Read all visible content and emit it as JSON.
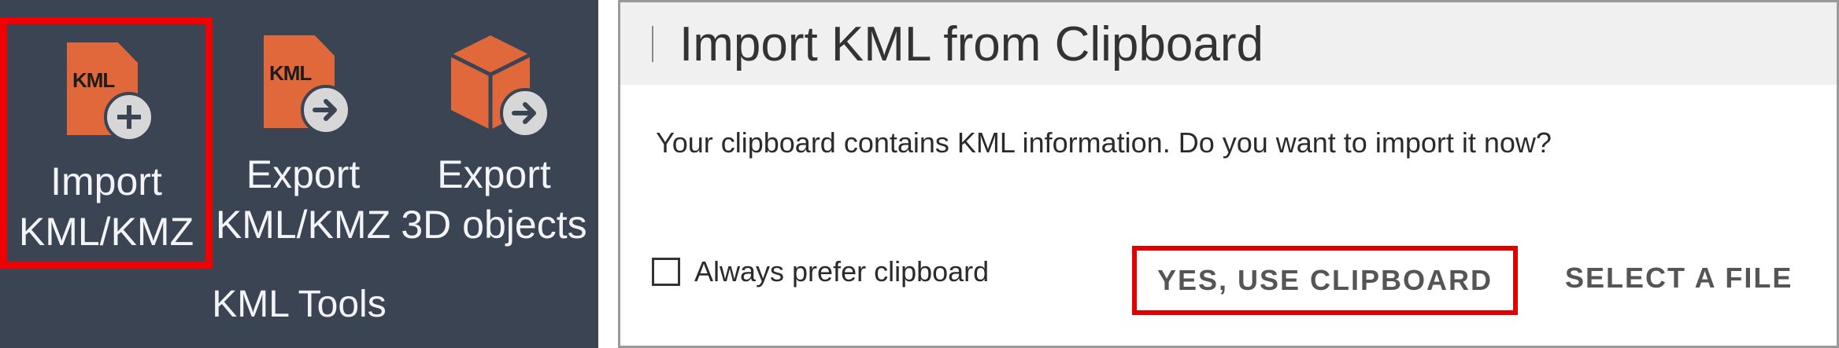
{
  "ribbon": {
    "group_label": "KML Tools",
    "buttons": [
      {
        "id": "import",
        "line1": "Import",
        "line2": "KML/KMZ",
        "doc_text": "KML",
        "badge_icon": "plus-icon"
      },
      {
        "id": "export-kml",
        "line1": "Export",
        "line2": "KML/KMZ",
        "doc_text": "KML",
        "badge_icon": "arrow-right-icon"
      },
      {
        "id": "export-3d",
        "line1": "Export",
        "line2": "3D objects",
        "badge_icon": "arrow-right-icon"
      }
    ]
  },
  "dialog": {
    "title": "Import KML from Clipboard",
    "message": "Your clipboard contains KML information. Do you want to import it now?",
    "checkbox_label": "Always prefer clipboard",
    "checkbox_checked": false,
    "primary_button": "YES, USE CLIPBOARD",
    "secondary_button": "SELECT A FILE"
  },
  "colors": {
    "ribbon_bg": "#3b4453",
    "icon_orange": "#e0683a",
    "highlight_red": "#f00000"
  }
}
